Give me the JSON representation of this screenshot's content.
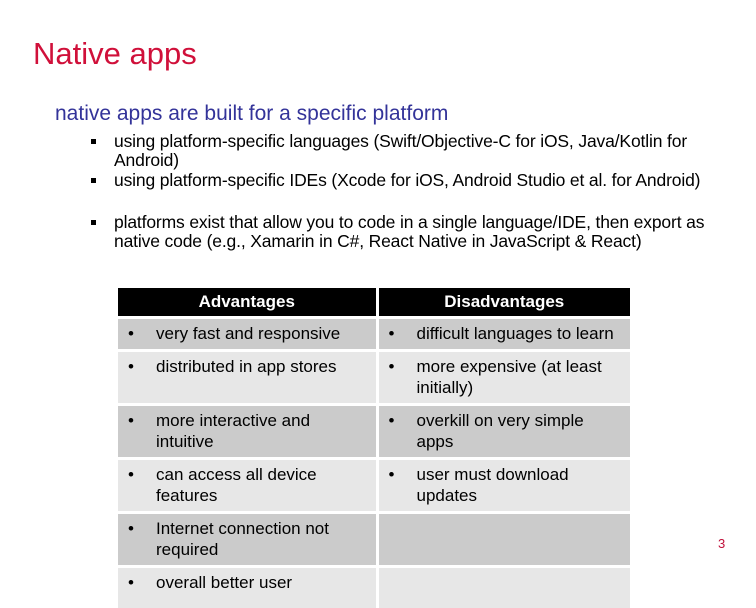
{
  "slide": {
    "title": "Native apps",
    "lead": "native apps are built for a specific platform",
    "bullets": [
      "using platform-specific languages (Swift/Objective-C for iOS, Java/Kotlin for Android)",
      "using platform-specific IDEs (Xcode for iOS, Android Studio et al. for Android)",
      "platforms exist that allow you to code in a single language/IDE, then export as native code (e.g., Xamarin in C#, React Native in JavaScript & React)"
    ],
    "page_number": "3",
    "colors": {
      "title": "#d0103a",
      "lead": "#333399",
      "header_bg": "#000000",
      "row_dark": "#cbcbcb",
      "row_light": "#e7e7e7"
    }
  },
  "table": {
    "headers": [
      "Advantages",
      "Disadvantages"
    ],
    "bullet_glyph": "•",
    "rows": [
      {
        "advantage": "very fast and responsive",
        "disadvantage": "difficult languages to learn"
      },
      {
        "advantage": "distributed in app stores",
        "disadvantage": "more expensive (at least initially)"
      },
      {
        "advantage": "more interactive and intuitive",
        "disadvantage": "overkill on very simple apps"
      },
      {
        "advantage": "can access all device features",
        "disadvantage": "user must download updates"
      },
      {
        "advantage": "Internet connection not required",
        "disadvantage": ""
      },
      {
        "advantage": "overall better user",
        "disadvantage": ""
      }
    ]
  }
}
